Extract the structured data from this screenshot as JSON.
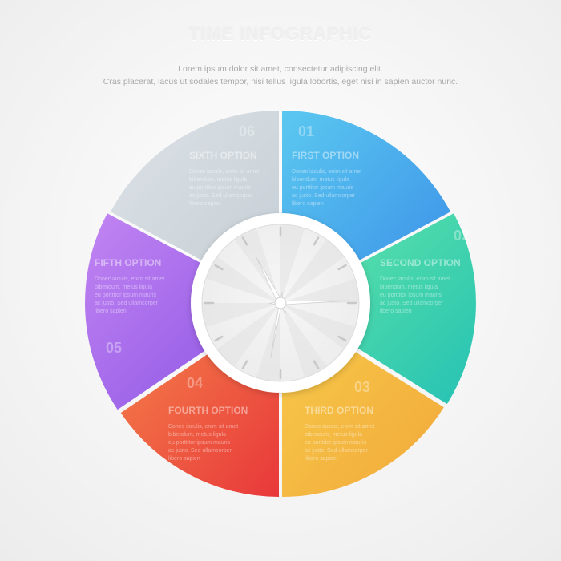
{
  "title": "TIME INFOGRAPHIC",
  "subtitle_line1": "Lorem ipsum dolor sit amet, consectetur adipiscing elit.",
  "subtitle_line2": "Cras placerat, lacus ut sodales tempor, nisi tellus ligula lobortis, eget nisi in sapien auctor nunc.",
  "segments": [
    {
      "key": "first",
      "number": "01",
      "title": "FIRST OPTION",
      "color_a": "#5bc8f0",
      "color_b": "#3a8fe8",
      "body": [
        "Donec iaculis, enim sit amet",
        "bibendum, metus ligula",
        "eu porttitor ipsum mauris",
        "ac justo. Sed ullamcorper",
        "libero sapien"
      ]
    },
    {
      "key": "second",
      "number": "02",
      "title": "SECOND OPTION",
      "color_a": "#63e6a6",
      "color_b": "#25c2b4",
      "body": [
        "Donec iaculis, enim sit amet",
        "bibendum, metus ligula",
        "eu porttitor ipsum mauris",
        "ac justo. Sed ullamcorper",
        "libero sapien"
      ]
    },
    {
      "key": "third",
      "number": "03",
      "title": "THIRD OPTION",
      "color_a": "#f7cb4b",
      "color_b": "#f2a83a",
      "body": [
        "Donec iaculis, enim sit amet",
        "bibendum, metus ligula",
        "eu porttitor ipsum mauris",
        "ac justo. Sed ullamcorper",
        "libero sapien"
      ]
    },
    {
      "key": "fourth",
      "number": "04",
      "title": "FOURTH OPTION",
      "color_a": "#f5844a",
      "color_b": "#e8383a",
      "body": [
        "Donec iaculis, enim sit amet",
        "bibendum, metus ligula",
        "eu porttitor ipsum mauris",
        "ac justo. Sed ullamcorper",
        "libero sapien"
      ]
    },
    {
      "key": "fifth",
      "number": "05",
      "title": "FIFTH OPTION",
      "color_a": "#c285f2",
      "color_b": "#8a52e4",
      "body": [
        "Donec iaculis, enim sit amet",
        "bibendum, metus ligula",
        "eu porttitor ipsum mauris",
        "ac justo. Sed ullamcorper",
        "libero sapien"
      ]
    },
    {
      "key": "sixth",
      "number": "06",
      "title": "SIXTH OPTION",
      "color_a": "#dde2e6",
      "color_b": "#c4ced5",
      "body": [
        "Donec iaculis, enim sit amet",
        "bibendum, metus ligula",
        "eu porttitor ipsum mauris",
        "ac justo. Sed ullamcorper",
        "libero sapien"
      ]
    }
  ],
  "clock": {
    "face_color": "#ececec",
    "rim_color": "#ffffff",
    "hand_color": "#ffffff"
  }
}
